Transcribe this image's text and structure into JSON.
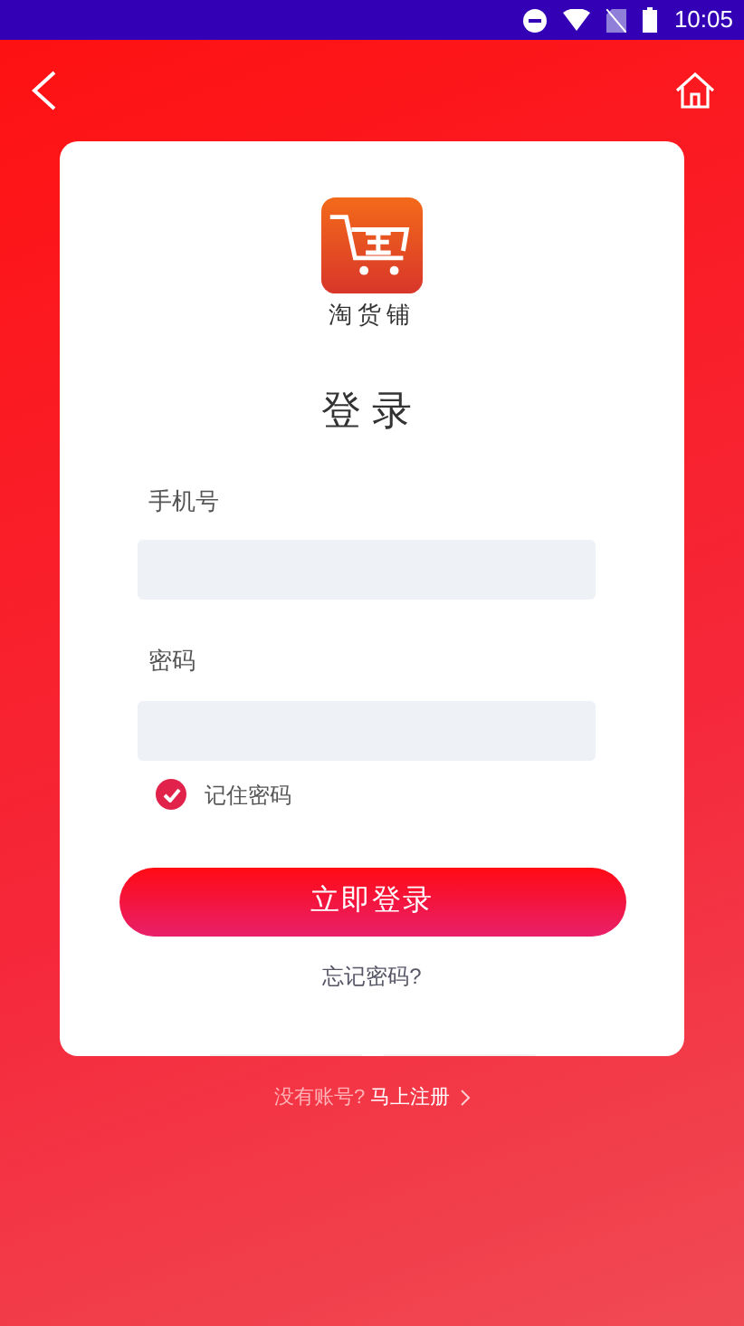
{
  "status_bar": {
    "time": "10:05"
  },
  "app": {
    "name": "淘货铺"
  },
  "title": "登录",
  "fields": [
    {
      "label": "手机号"
    },
    {
      "label": "密码"
    }
  ],
  "remember": {
    "label": "记住密码",
    "checked": true
  },
  "login_button": "立即登录",
  "forgot_link": "忘记密码?",
  "footer": {
    "prompt": "没有账号?",
    "link": "马上注册"
  }
}
